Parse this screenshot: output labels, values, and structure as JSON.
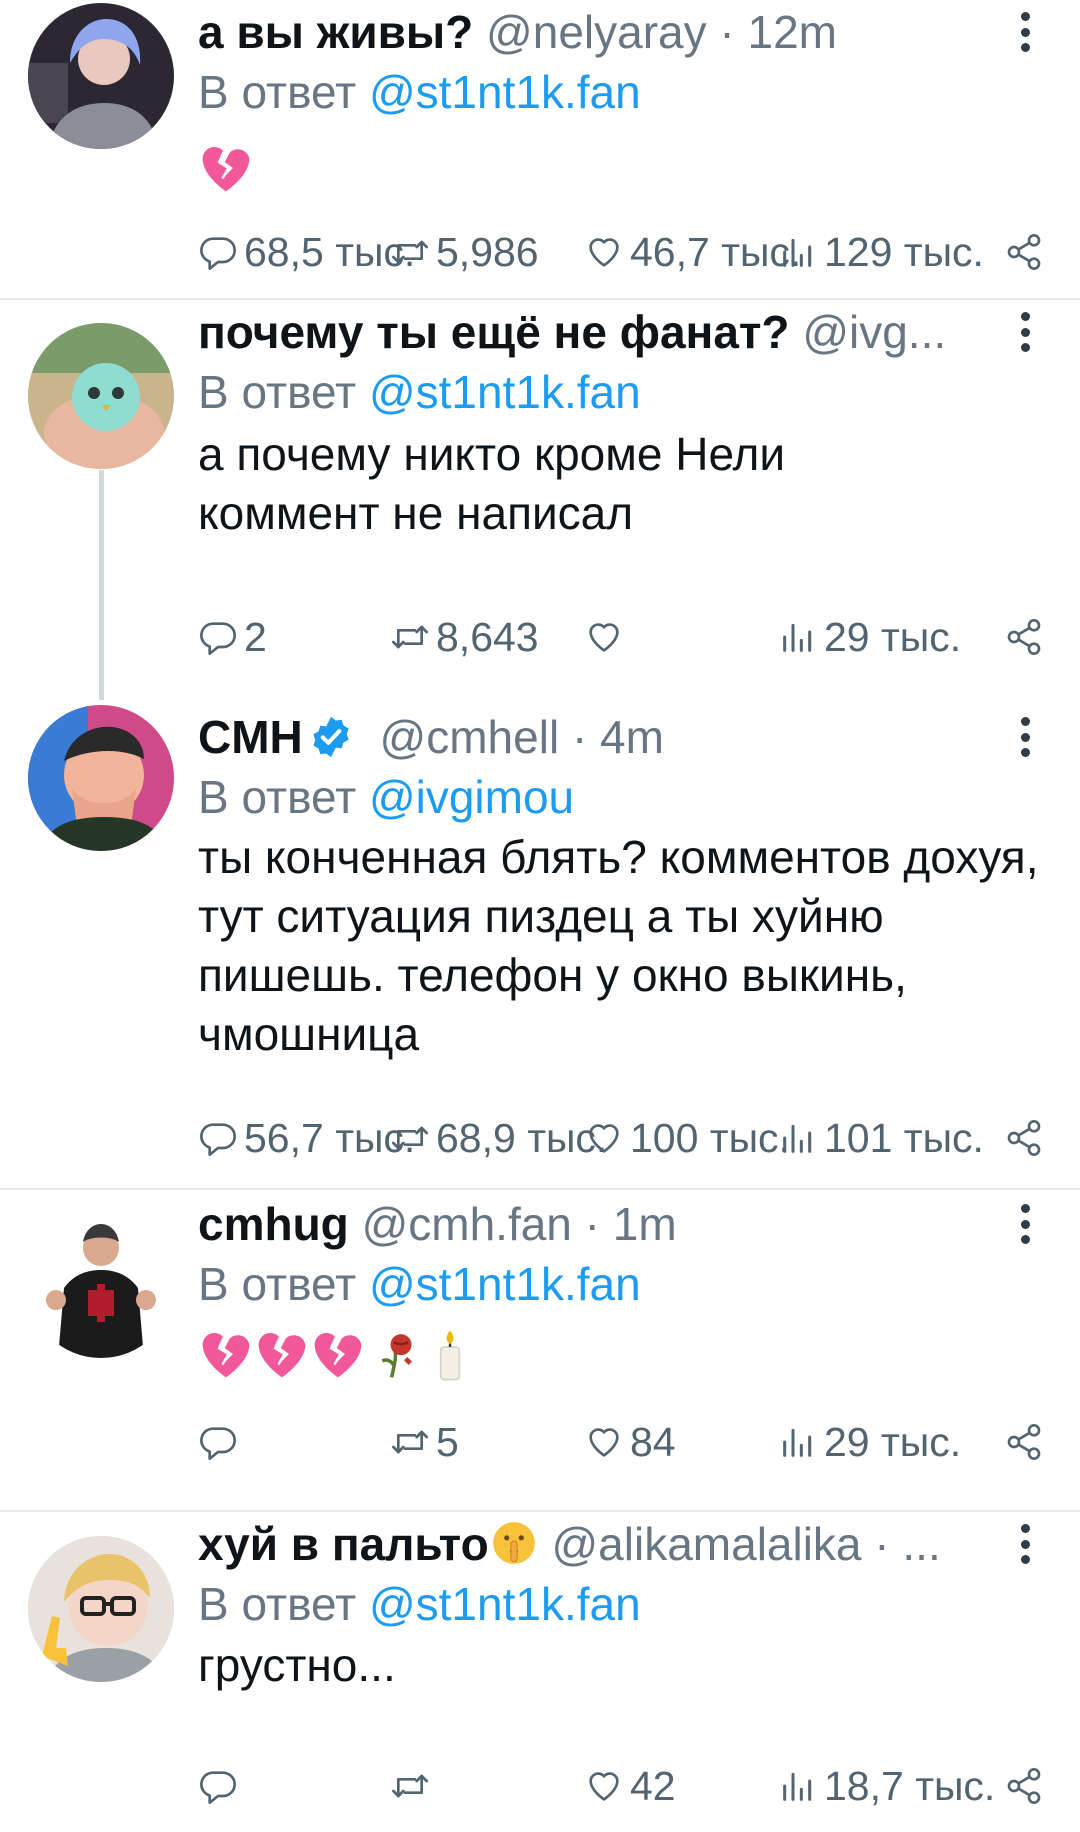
{
  "tweets": [
    {
      "name": "а вы живы?",
      "handle": "@nelyaray · 12m",
      "reply_prefix": "В ответ ",
      "reply_to": "@st1nt1k.fan",
      "body": "",
      "emoji": [
        "broken-heart"
      ],
      "replies": "68,5 тыс.",
      "retweets": "5,986",
      "likes": "46,7 тыс.",
      "views": "129 тыс."
    },
    {
      "name": "почему ты ещё не фанат?",
      "handle": "@ivg...",
      "reply_prefix": "В ответ ",
      "reply_to": "@st1nt1k.fan",
      "body": "а почему никто кроме Нели коммент не написал",
      "replies": "2",
      "retweets": "8,643",
      "likes": "",
      "views": "29 тыс."
    },
    {
      "name": "CMH",
      "verified": true,
      "handle": "@cmhell · 4m",
      "reply_prefix": "В ответ ",
      "reply_to": "@ivgimou",
      "body": "ты конченная блять? комментов дохуя, тут ситуация пиздец а ты хуйню пишешь. телефон у окно выкинь,  чмошница",
      "replies": "56,7 тыс.",
      "retweets": "68,9 тыс.",
      "likes": "100 тыс.",
      "views": "101 тыс."
    },
    {
      "name": "cmhug",
      "handle": "@cmh.fan · 1m",
      "reply_prefix": "В ответ ",
      "reply_to": "@st1nt1k.fan",
      "body": "",
      "emoji": [
        "broken-heart",
        "broken-heart",
        "broken-heart",
        "wilted-rose",
        "candle"
      ],
      "replies": "",
      "retweets": "5",
      "likes": "84",
      "views": "29 тыс."
    },
    {
      "name": "хуй в пальто",
      "name_emoji": "shushing-face",
      "handle": "@alikamalalika · ...",
      "reply_prefix": "В ответ ",
      "reply_to": "@st1nt1k.fan",
      "body": "грустно...",
      "replies": "",
      "retweets": "",
      "likes": "42",
      "views": "18,7 тыс."
    }
  ],
  "colors": {
    "link": "#1d9bf0",
    "muted": "#687684",
    "icon": "#536471",
    "divider": "#e6e9ec",
    "heart": "#f0589a"
  },
  "icons": [
    "reply-icon",
    "retweet-icon",
    "like-icon",
    "views-icon",
    "share-icon",
    "more-icon",
    "verified-badge-icon"
  ]
}
